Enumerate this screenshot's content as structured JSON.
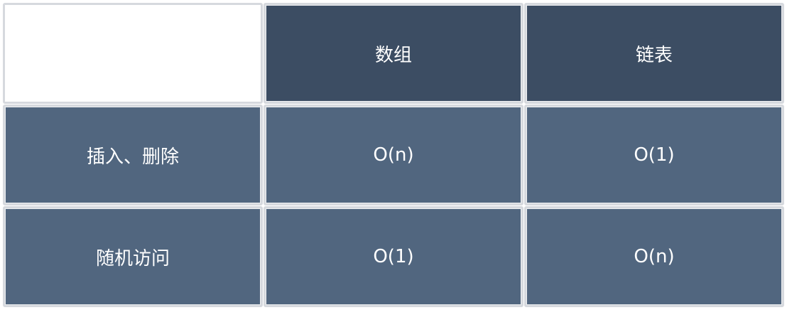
{
  "table": {
    "headers": [
      "",
      "数组",
      "链表"
    ],
    "rows": [
      {
        "label": "插入、删除",
        "values": [
          "O(n)",
          "O(1)"
        ]
      },
      {
        "label": "随机访问",
        "values": [
          "O(1)",
          "O(n)"
        ]
      }
    ]
  },
  "colors": {
    "header_bg": "#3c4d63",
    "cell_bg": "#51667f",
    "border": "#d6d9de",
    "text": "#ffffff"
  }
}
